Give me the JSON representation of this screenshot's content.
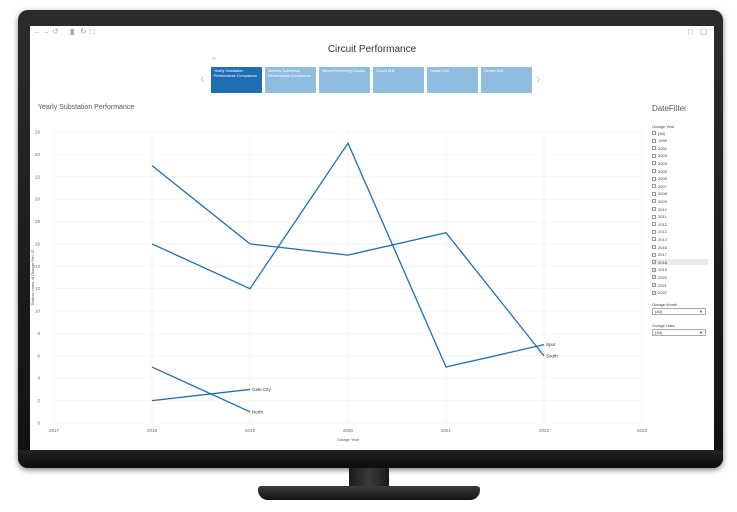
{
  "app": {
    "title": "Circuit Performance"
  },
  "toolbar": {
    "undo_icon": "undo-icon",
    "redo_icon": "redo-icon",
    "revert_icon": "revert-icon",
    "refresh_icon": "refresh-icon",
    "pause_icon": "pause-icon",
    "comment_icon": "comment-icon",
    "fullscreen_icon": "fullscreen-icon"
  },
  "story": {
    "points": [
      {
        "label": "Yearly Substation Performance Comparison",
        "active": true
      },
      {
        "label": "Monthly Substation Performance Comparison",
        "active": false
      },
      {
        "label": "Worst Performing Circuits",
        "active": false
      },
      {
        "label": "Circuit Drill",
        "active": false
      },
      {
        "label": "Cause Drill",
        "active": false
      },
      {
        "label": "Device Drill",
        "active": false
      }
    ]
  },
  "sheet": {
    "title": "Yearly Substation Performance"
  },
  "filters": {
    "title": "DateFilter",
    "year_label": "Outage Year",
    "years": [
      {
        "label": "(All)",
        "checked": false
      },
      {
        "label": "1999",
        "checked": false
      },
      {
        "label": "2002",
        "checked": false
      },
      {
        "label": "2003",
        "checked": false
      },
      {
        "label": "2004",
        "checked": false
      },
      {
        "label": "2005",
        "checked": false
      },
      {
        "label": "2006",
        "checked": false
      },
      {
        "label": "2007",
        "checked": false
      },
      {
        "label": "2008",
        "checked": false
      },
      {
        "label": "2009",
        "checked": false
      },
      {
        "label": "2010",
        "checked": false
      },
      {
        "label": "2011",
        "checked": false
      },
      {
        "label": "2012",
        "checked": false
      },
      {
        "label": "2013",
        "checked": false
      },
      {
        "label": "2014",
        "checked": false
      },
      {
        "label": "2016",
        "checked": false
      },
      {
        "label": "2017",
        "checked": false
      },
      {
        "label": "2018",
        "checked": true
      },
      {
        "label": "2019",
        "checked": true
      },
      {
        "label": "2020",
        "checked": true
      },
      {
        "label": "2021",
        "checked": true
      },
      {
        "label": "2022",
        "checked": true
      }
    ],
    "month_label": "Outage Month",
    "month_value": "(All)",
    "date_label": "Outage Date",
    "date_value": "(All)"
  },
  "chart_data": {
    "type": "line",
    "xlabel": "Outage Year",
    "ylabel": "Distinct count of Outage Rec ID",
    "xlim": [
      2017,
      2023
    ],
    "ylim": [
      0,
      26
    ],
    "x_ticks": [
      "2017",
      "2018",
      "2019",
      "2020",
      "2021",
      "2022",
      "2023"
    ],
    "y_ticks": [
      0,
      2,
      4,
      6,
      8,
      10,
      12,
      14,
      16,
      18,
      20,
      22,
      24,
      26
    ],
    "grid": true,
    "color": "#1f6db3",
    "series": [
      {
        "name": "Spur",
        "x": [
          2018,
          2019,
          2020,
          2021,
          2022
        ],
        "y": [
          16,
          12,
          25,
          5,
          7
        ]
      },
      {
        "name": "South",
        "x": [
          2018,
          2019,
          2020,
          2021,
          2022
        ],
        "y": [
          23,
          16,
          15,
          17,
          6
        ]
      },
      {
        "name": "Gate City",
        "x": [
          2018,
          2019
        ],
        "y": [
          2,
          3
        ]
      },
      {
        "name": "North",
        "x": [
          2018,
          2019
        ],
        "y": [
          5,
          1
        ]
      }
    ]
  }
}
